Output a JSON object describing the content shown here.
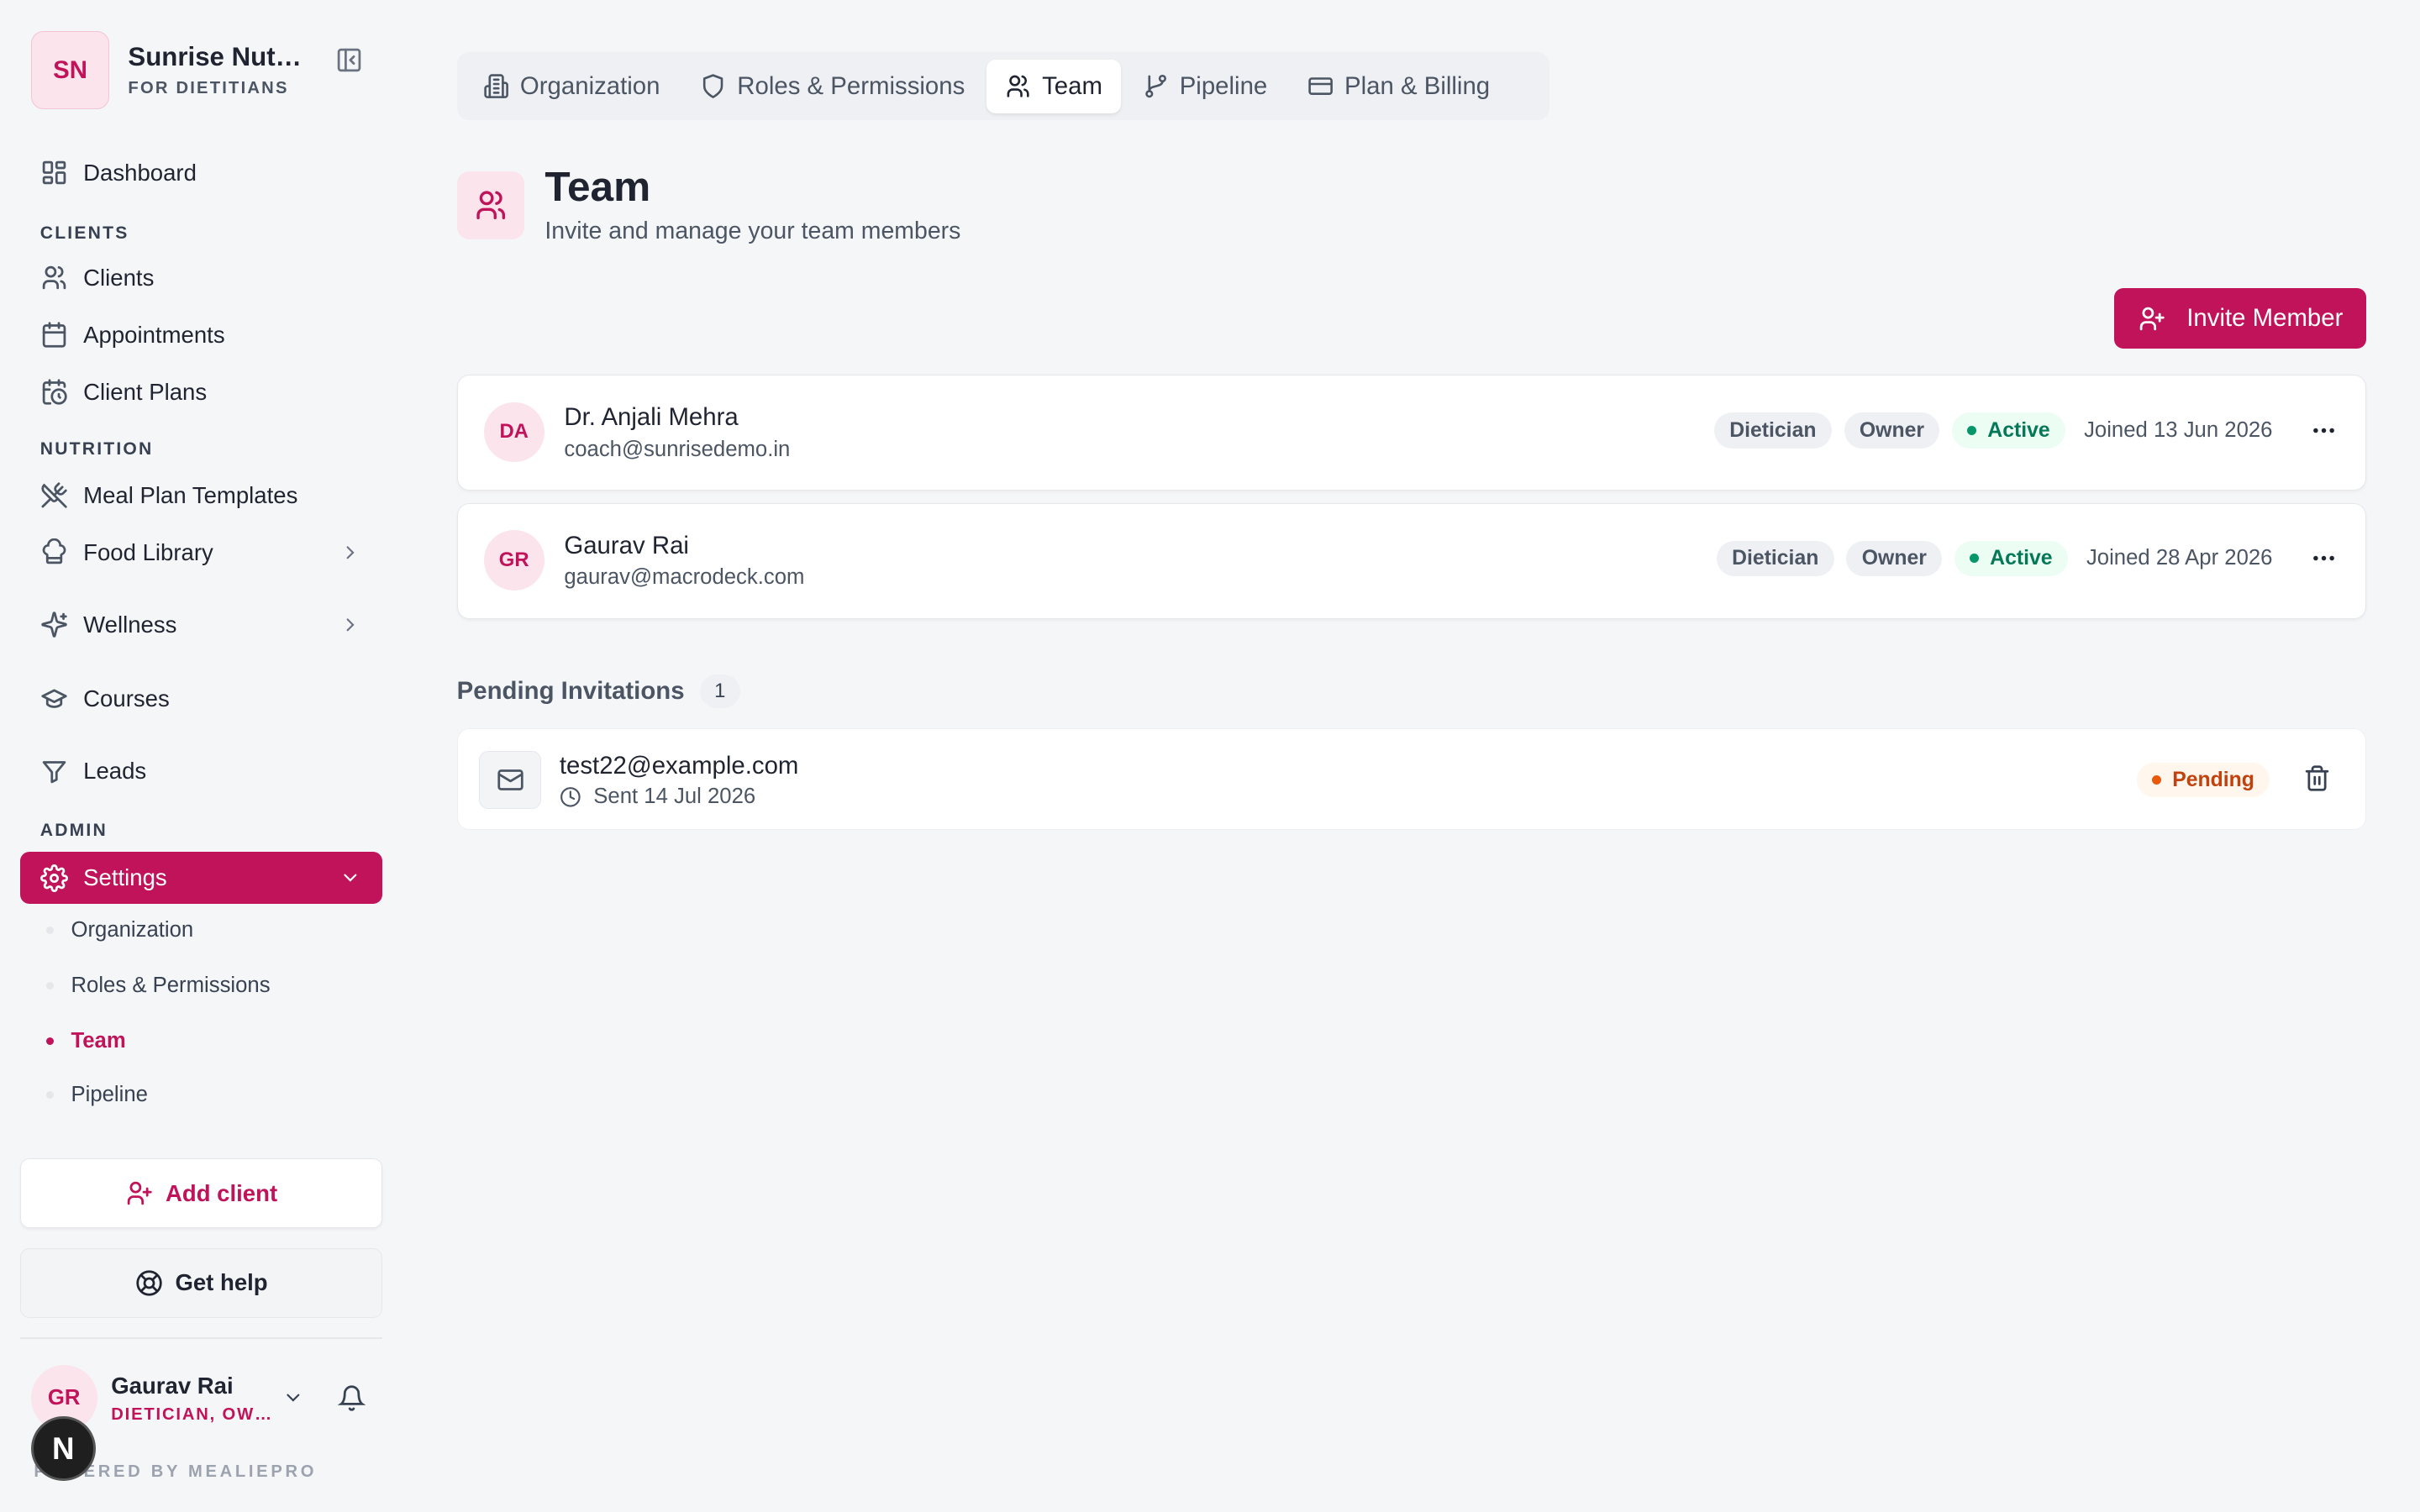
{
  "brand": {
    "initials": "SN",
    "name": "Sunrise Nutrition",
    "subtitle": "FOR DIETITIANS"
  },
  "sidebar": {
    "items": [
      {
        "label": "Dashboard"
      },
      {
        "label": "Clients"
      },
      {
        "label": "Appointments"
      },
      {
        "label": "Client Plans"
      },
      {
        "label": "Meal Plan Templates"
      },
      {
        "label": "Food Library"
      },
      {
        "label": "Wellness"
      },
      {
        "label": "Courses"
      },
      {
        "label": "Leads"
      },
      {
        "label": "Settings"
      }
    ],
    "sections": {
      "clients": "CLIENTS",
      "nutrition": "NUTRITION",
      "admin": "ADMIN"
    },
    "settings_sub": [
      {
        "label": "Organization"
      },
      {
        "label": "Roles & Permissions"
      },
      {
        "label": "Team"
      },
      {
        "label": "Pipeline"
      }
    ],
    "add_client": "Add client",
    "get_help": "Get help"
  },
  "user": {
    "initials": "GR",
    "name": "Gaurav Rai",
    "role": "DIETICIAN, OWNER"
  },
  "footer": {
    "powered": "POWERED BY MEALIEPRO",
    "next_badge": "N"
  },
  "tabs": [
    {
      "label": "Organization"
    },
    {
      "label": "Roles & Permissions"
    },
    {
      "label": "Team"
    },
    {
      "label": "Pipeline"
    },
    {
      "label": "Plan & Billing"
    }
  ],
  "page": {
    "title": "Team",
    "subtitle": "Invite and manage your team members",
    "invite_button": "Invite Member"
  },
  "members": [
    {
      "initials": "DA",
      "name": "Dr. Anjali Mehra",
      "email": "coach@sunrisedemo.in",
      "role": "Dietician",
      "access": "Owner",
      "status": "Active",
      "joined": "Joined 13 Jun 2026"
    },
    {
      "initials": "GR",
      "name": "Gaurav Rai",
      "email": "gaurav@macrodeck.com",
      "role": "Dietician",
      "access": "Owner",
      "status": "Active",
      "joined": "Joined 28 Apr 2026"
    }
  ],
  "pending": {
    "title": "Pending Invitations",
    "count": "1",
    "invites": [
      {
        "email": "test22@example.com",
        "sent": "Sent 14 Jul 2026",
        "status": "Pending"
      }
    ]
  },
  "colors": {
    "accent": "#c0135a",
    "active_green": "#047857",
    "pending_orange": "#c2410c"
  }
}
